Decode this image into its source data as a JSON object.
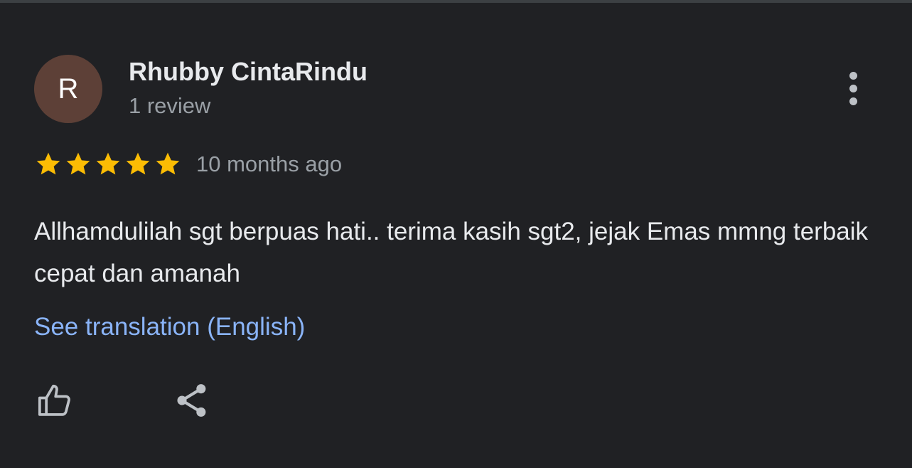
{
  "review": {
    "author": {
      "initial": "R",
      "name": "Rhubby CintaRindu",
      "review_count": "1 review",
      "avatar_color": "#5d4037"
    },
    "rating": 5,
    "max_rating": 5,
    "time": "10 months ago",
    "text": "Allhamdulilah sgt berpuas hati.. terima kasih sgt2, jejak Emas mmng terbaik cepat dan amanah",
    "translate_link": "See translation (English)"
  },
  "actions": {
    "more_icon": "more-vert-icon",
    "like_icon": "thumb-up-icon",
    "share_icon": "share-icon"
  },
  "colors": {
    "background": "#202124",
    "star": "#fbbc04",
    "link": "#8ab4f8",
    "primary_text": "#e8eaed",
    "secondary_text": "#9aa0a6"
  }
}
